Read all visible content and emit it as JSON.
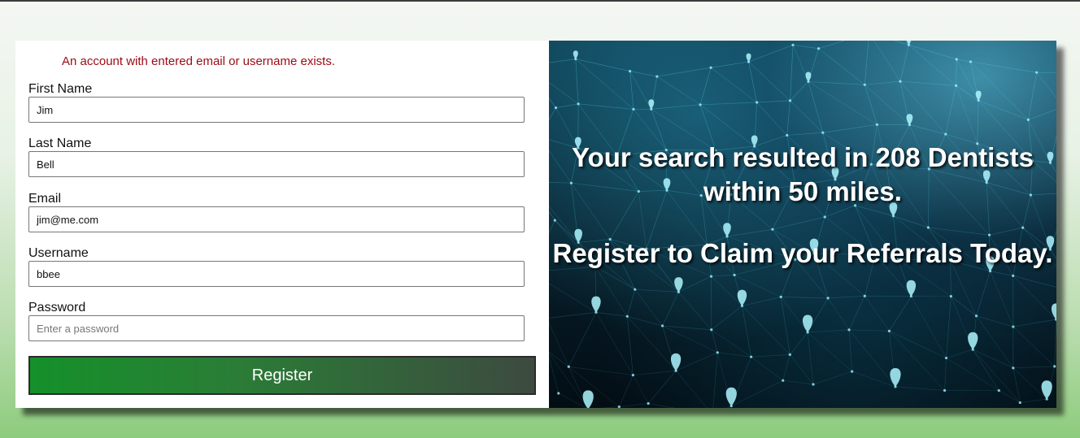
{
  "form": {
    "error_message": "An account with entered email or username exists.",
    "fields": [
      {
        "label": "First Name",
        "value": "Jim",
        "placeholder": ""
      },
      {
        "label": "Last Name",
        "value": "Bell",
        "placeholder": ""
      },
      {
        "label": "Email",
        "value": "jim@me.com",
        "placeholder": ""
      },
      {
        "label": "Username",
        "value": "bbee",
        "placeholder": ""
      },
      {
        "label": "Password",
        "value": "",
        "placeholder": "Enter a password"
      }
    ],
    "register_label": "Register"
  },
  "promo": {
    "line1": "Your search resulted in 208 Dentists within 50 miles.",
    "line2": "Register to Claim your Referrals Today."
  },
  "colors": {
    "error": "#9b0a14",
    "button_start": "#15902a",
    "button_end": "#3d4a40",
    "network_accent": "#4fd6f0"
  },
  "icons": {
    "background": "network-map-pins-image"
  }
}
